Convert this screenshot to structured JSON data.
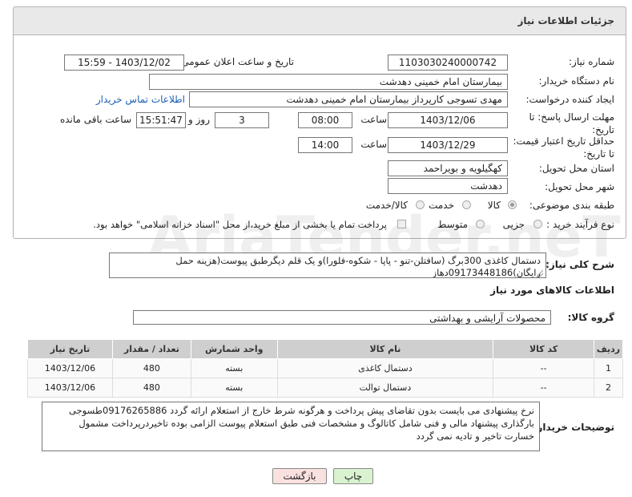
{
  "header": {
    "title": "جزئیات اطلاعات نیاز"
  },
  "need_number": {
    "label": "شماره نیاز:",
    "value": "1103030240000742"
  },
  "announce": {
    "label": "تاریخ و ساعت اعلان عمومی:",
    "value": "1403/12/02 - 15:59"
  },
  "buyer_org": {
    "label": "نام دستگاه خریدار:",
    "value": "بیمارستان امام خمینی دهدشت"
  },
  "requester": {
    "label": "ایجاد کننده درخواست:",
    "value": "مهدی تسوجی کارپرداز بیمارستان امام خمینی دهدشت",
    "contact_link": "اطلاعات تماس خریدار"
  },
  "deadline": {
    "label": "مهلت ارسال پاسخ: تا تاریخ:",
    "date": "1403/12/06",
    "time_label": "ساعت",
    "time": "08:00",
    "days": "3",
    "days_label": "روز و",
    "remaining": "15:51:47",
    "remaining_label": "ساعت باقی مانده"
  },
  "validity": {
    "label": "حداقل تاریخ اعتبار قیمت: تا تاریخ:",
    "date": "1403/12/29",
    "time_label": "ساعت",
    "time": "14:00"
  },
  "province": {
    "label": "استان محل تحویل:",
    "value": "کهگیلویه و بویراحمد"
  },
  "city": {
    "label": "شهر محل تحویل:",
    "value": "دهدشت"
  },
  "category": {
    "label": "طبقه بندی موضوعی:",
    "options": [
      "کالا",
      "خدمت",
      "کالا/خدمت"
    ]
  },
  "process": {
    "label": "نوع فرآیند خرید :",
    "options": [
      "جزیی",
      "متوسط"
    ],
    "payment_note": "پرداخت تمام یا بخشی از مبلغ خرید،از محل \"اسناد خزانه اسلامی\" خواهد بود."
  },
  "description": {
    "label": "شرح کلی نیاز:",
    "value": "دستمال کاغذی 300برگ (سافتلن-تنو - پاپا - شکوه-فلورا)و یک قلم دیگرطبق پیوست(هزینه حمل رایگان)09173448186دهاز"
  },
  "goods_info": {
    "title": "اطلاعات کالاهای مورد نیاز"
  },
  "goods_group": {
    "label": "گروه کالا:",
    "value": "محصولات آرایشی و بهداشتی"
  },
  "table": {
    "headers": [
      "ردیف",
      "کد کالا",
      "نام کالا",
      "واحد شمارش",
      "تعداد / مقدار",
      "تاریخ نیاز"
    ],
    "rows": [
      [
        "1",
        "--",
        "دستمال کاغذی",
        "بسته",
        "480",
        "1403/12/06"
      ],
      [
        "2",
        "--",
        "دستمال توالت",
        "بسته",
        "480",
        "1403/12/06"
      ]
    ]
  },
  "buyer_notes": {
    "label": "توضیحات خریدار:",
    "value": "نرخ پیشنهادی می بایست بدون تقاضای پیش پرداخت و هرگونه شرط خارج از استعلام ارائه گردد 09176265886طسوجی بارگذاری پیشنهاد مالی و فنی شامل کاتالوگ و مشخصات فنی طبق استعلام پیوست الزامی بوده تاخیردرپرداخت مشمول خسارت تاخیر و تادیه نمی گردد"
  },
  "buttons": {
    "print": "چاپ",
    "back": "بازگشت"
  },
  "watermark": {
    "text": "AriaTender.neT"
  },
  "colors": {
    "header_bg": "#e9e9e9",
    "table_header": "#cfcfcf",
    "link": "#1a5fb4",
    "print_btn": "#d9f2d0",
    "back_btn": "#fbe0e0"
  }
}
